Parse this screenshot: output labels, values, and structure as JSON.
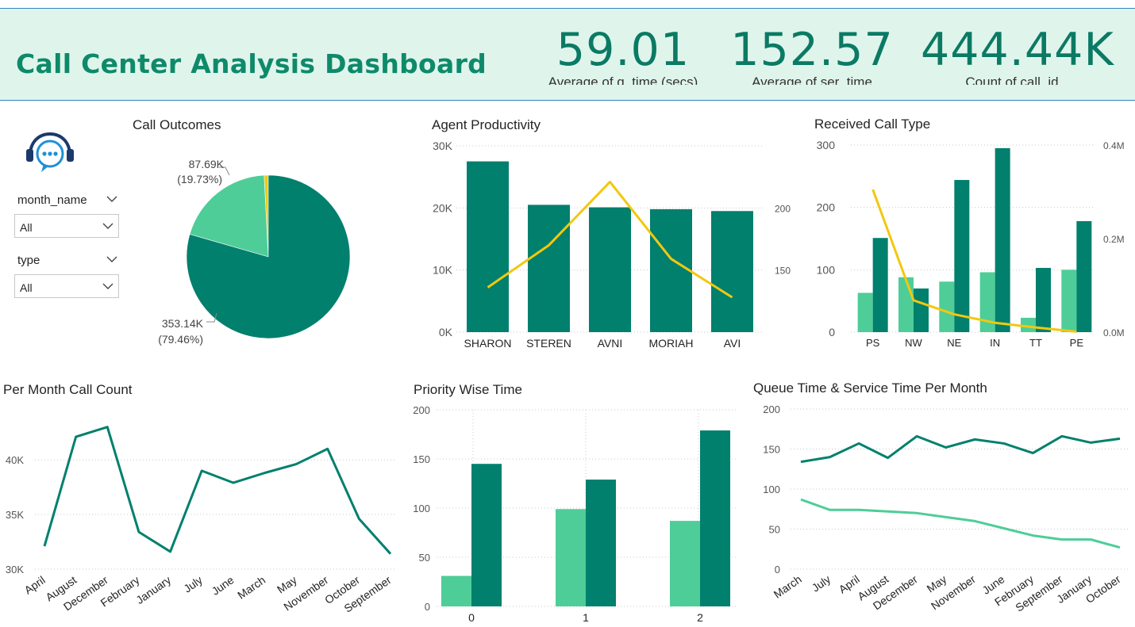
{
  "header": {
    "title": "Call Center Analysis Dashboard",
    "kpis": [
      {
        "value": "59.01",
        "label": "Average of q_time (secs)"
      },
      {
        "value": "152.57",
        "label": "Average of ser_time"
      },
      {
        "value": "444.44K",
        "label": "Count of call_id"
      }
    ]
  },
  "slicers": {
    "month": {
      "label": "month_name",
      "value": "All"
    },
    "type": {
      "label": "type",
      "value": "All"
    }
  },
  "colors": {
    "dark": "#00806d",
    "light": "#4ecd98",
    "yellow": "#f2c80f",
    "grid": "#c8c8c8"
  },
  "chart_data": [
    {
      "id": "call_outcomes",
      "type": "pie",
      "title": "Call Outcomes",
      "slices": [
        {
          "value": 353.14,
          "label": "353.14K",
          "pct": "(79.46%)",
          "color": "#00806d"
        },
        {
          "value": 87.69,
          "label": "87.69K",
          "pct": "(19.73%)",
          "color": "#4ecd98"
        },
        {
          "value": 3.6,
          "label": "",
          "pct": "",
          "color": "#f2c80f"
        }
      ]
    },
    {
      "id": "agent_productivity",
      "type": "bar",
      "title": "Agent Productivity",
      "categories": [
        "SHARON",
        "STEREN",
        "AVNI",
        "MORIAH",
        "AVI"
      ],
      "values": [
        27500,
        20500,
        20100,
        19800,
        19500
      ],
      "line_values": [
        136,
        170,
        221,
        159,
        128
      ],
      "ylim": [
        0,
        30000
      ],
      "yticks": [
        "0K",
        "10K",
        "20K",
        "30K"
      ],
      "y2ticks": [
        "150",
        "200"
      ],
      "y2lim": [
        100,
        250
      ]
    },
    {
      "id": "received_call_type",
      "type": "bar",
      "title": "Received Call Type",
      "categories": [
        "PS",
        "NW",
        "NE",
        "IN",
        "TT",
        "PE"
      ],
      "series": [
        {
          "values": [
            63,
            88,
            81,
            96,
            23,
            100
          ]
        },
        {
          "values": [
            151,
            70,
            244,
            295,
            103,
            178
          ]
        }
      ],
      "line_values": [
        0.305,
        0.068,
        0.038,
        0.02,
        0.01,
        0.001
      ],
      "ylim": [
        0,
        300
      ],
      "yticks": [
        "0",
        "100",
        "200",
        "300"
      ],
      "y2lim": [
        0,
        0.4
      ],
      "y2ticks": [
        "0.0M",
        "0.2M",
        "0.4M"
      ]
    },
    {
      "id": "per_month_call_count",
      "type": "line",
      "title": "Per Month Call Count",
      "categories": [
        "April",
        "August",
        "December",
        "February",
        "January",
        "July",
        "June",
        "March",
        "May",
        "November",
        "October",
        "September"
      ],
      "values": [
        32100,
        42100,
        43000,
        33400,
        31600,
        39000,
        37900,
        38800,
        39600,
        41000,
        34600,
        31400
      ],
      "ylim": [
        30000,
        44500
      ],
      "yticks": [
        "30K",
        "35K",
        "40K"
      ]
    },
    {
      "id": "priority_wise_time",
      "type": "bar",
      "title": "Priority Wise Time",
      "categories": [
        "0",
        "1",
        "2"
      ],
      "series": [
        {
          "values": [
            31,
            99,
            87
          ]
        },
        {
          "values": [
            145,
            129,
            179
          ]
        }
      ],
      "ylim": [
        0,
        200
      ],
      "yticks": [
        "0",
        "50",
        "100",
        "150",
        "200"
      ]
    },
    {
      "id": "queue_service_time",
      "type": "line",
      "title": "Queue Time & Service Time Per Month",
      "categories": [
        "March",
        "July",
        "April",
        "August",
        "December",
        "May",
        "November",
        "June",
        "February",
        "September",
        "January",
        "October"
      ],
      "series": [
        {
          "values": [
            134,
            140,
            157,
            139,
            166,
            152,
            162,
            157,
            145,
            166,
            158,
            163
          ]
        },
        {
          "values": [
            87,
            74,
            74,
            72,
            70,
            65,
            60,
            51,
            42,
            37,
            37,
            27
          ]
        }
      ],
      "ylim": [
        0,
        200
      ],
      "yticks": [
        "0",
        "50",
        "100",
        "150",
        "200"
      ]
    }
  ]
}
